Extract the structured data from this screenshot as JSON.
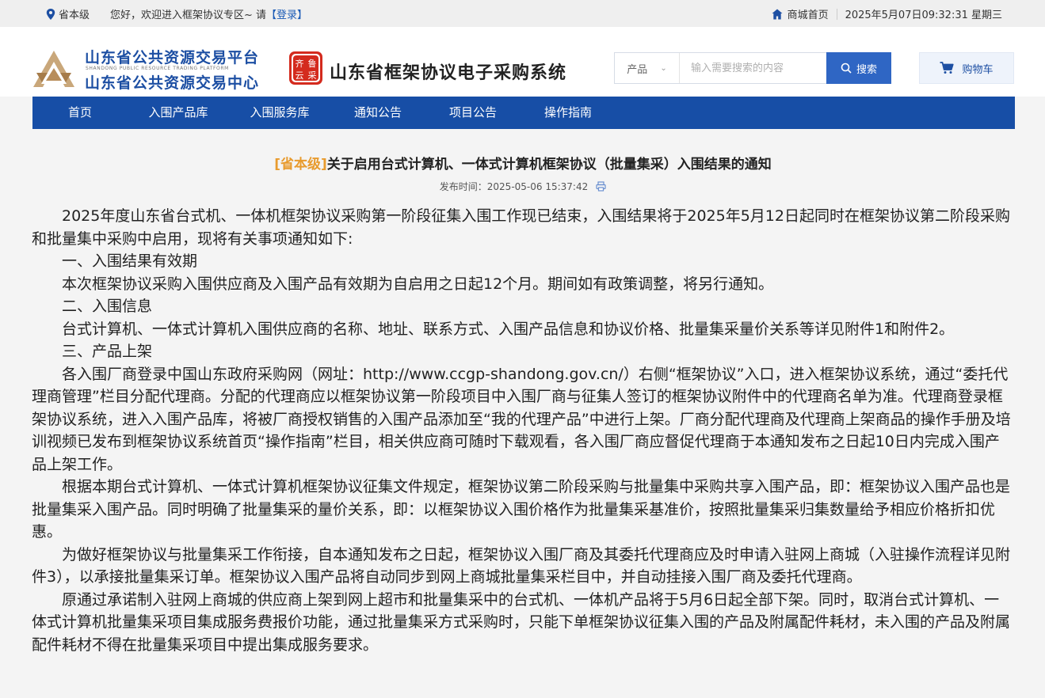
{
  "topbar": {
    "region": "省本级",
    "welcome": "您好，欢迎进入框架协议专区~  请",
    "login": "【登录】",
    "home": "商城首页",
    "datetime": "2025年5月07日09:32:31  星期三"
  },
  "header": {
    "org_line1": "山东省公共资源交易平台",
    "org_en": "SHANDONG PUBLIC RESOURCE TRADING PLATFORM",
    "org_line2": "山东省公共资源交易中心",
    "seal_chars": [
      "齐",
      "鲁",
      "云",
      "采"
    ],
    "system_title": "山东省框架协议电子采购系统",
    "accent_color": "#174ea6"
  },
  "search": {
    "category": "产品",
    "placeholder": "输入需要搜索的内容",
    "button": "搜索"
  },
  "cart": {
    "label": "购物车"
  },
  "nav": {
    "items": [
      {
        "label": "首页"
      },
      {
        "label": "入围产品库"
      },
      {
        "label": "入围服务库"
      },
      {
        "label": "通知公告"
      },
      {
        "label": "项目公告"
      },
      {
        "label": "操作指南"
      }
    ]
  },
  "article": {
    "tag": "[省本级]",
    "title": "关于启用台式计算机、一体式计算机框架协议（批量集采）入围结果的通知",
    "publish_label": "发布时间：",
    "publish_time": "2025-05-06 15:37:42",
    "paragraphs": [
      "2025年度山东省台式机、一体机框架协议采购第一阶段征集入围工作现已结束，入围结果将于2025年5月12日起同时在框架协议第二阶段采购和批量集中采购中启用，现将有关事项通知如下:",
      "一、入围结果有效期",
      "本次框架协议采购入围供应商及入围产品有效期为自启用之日起12个月。期间如有政策调整，将另行通知。",
      "二、入围信息",
      "台式计算机、一体式计算机入围供应商的名称、地址、联系方式、入围产品信息和协议价格、批量集采量价关系等详见附件1和附件2。",
      "三、产品上架",
      "各入围厂商登录中国山东政府采购网（网址：http://www.ccgp-shandong.gov.cn/）右侧“框架协议”入口，进入框架协议系统，通过“委托代理商管理”栏目分配代理商。分配的代理商应以框架协议第一阶段项目中入围厂商与征集人签订的框架协议附件中的代理商名单为准。代理商登录框架协议系统，进入入围产品库，将被厂商授权销售的入围产品添加至“我的代理产品”中进行上架。厂商分配代理商及代理商上架商品的操作手册及培训视频已发布到框架协议系统首页“操作指南”栏目，相关供应商可随时下载观看，各入围厂商应督促代理商于本通知发布之日起10日内完成入围产品上架工作。",
      "根据本期台式计算机、一体式计算机框架协议征集文件规定，框架协议第二阶段采购与批量集中采购共享入围产品，即：框架协议入围产品也是批量集采入围产品。同时明确了批量集采的量价关系，即：以框架协议入围价格作为批量集采基准价，按照批量集采归集数量给予相应价格折扣优惠。",
      "为做好框架协议与批量集采工作衔接，自本通知发布之日起，框架协议入围厂商及其委托代理商应及时申请入驻网上商城（入驻操作流程详见附件3），以承接批量集采订单。框架协议入围产品将自动同步到网上商城批量集采栏目中，并自动挂接入围厂商及委托代理商。",
      "原通过承诺制入驻网上商城的供应商上架到网上超市和批量集采中的台式机、一体机产品将于5月6日起全部下架。同时，取消台式计算机、一体式计算机批量集采项目集成服务费报价功能，通过批量集采方式采购时，只能下单框架协议征集入围的产品及附属配件耗材，未入围的产品及附属配件耗材不得在批量集采项目中提出集成服务要求。"
    ]
  }
}
